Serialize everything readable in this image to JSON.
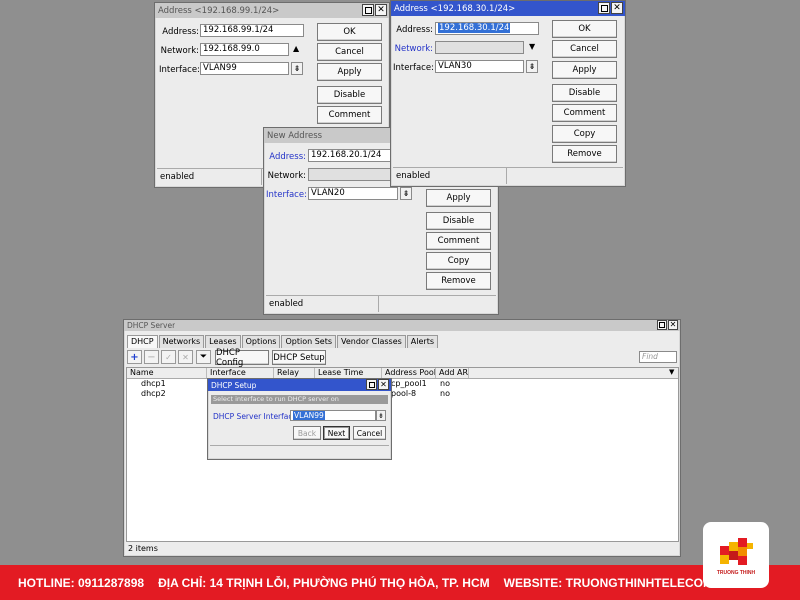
{
  "win1": {
    "title": "Address <192.168.99.1/24>",
    "address_label": "Address:",
    "address": "192.168.99.1/24",
    "network_label": "Network:",
    "network": "192.168.99.0",
    "interface_label": "Interface:",
    "interface": "VLAN99",
    "buttons": [
      "OK",
      "Cancel",
      "Apply",
      "Disable",
      "Comment"
    ],
    "status": "enabled"
  },
  "win2": {
    "title": "Address <192.168.30.1/24>",
    "address_label": "Address:",
    "address": "192.168.30.1/24",
    "network_label": "Network:",
    "network": "",
    "interface_label": "Interface:",
    "interface": "VLAN30",
    "buttons": [
      "OK",
      "Cancel",
      "Apply",
      "Disable",
      "Comment",
      "Copy",
      "Remove"
    ],
    "status": "enabled"
  },
  "win3": {
    "title": "New Address",
    "address_label": "Address:",
    "address": "192.168.20.1/24",
    "network_label": "Network:",
    "network": "",
    "interface_label": "Interface:",
    "interface": "VLAN20",
    "buttons": [
      "Apply",
      "Disable",
      "Comment",
      "Copy",
      "Remove"
    ],
    "status": "enabled"
  },
  "dhcp": {
    "title": "DHCP Server",
    "tabs": [
      "DHCP",
      "Networks",
      "Leases",
      "Options",
      "Option Sets",
      "Vendor Classes",
      "Alerts"
    ],
    "config_button": "DHCP Config",
    "setup_button": "DHCP Setup",
    "find_placeholder": "Find",
    "columns": [
      "Name",
      "Interface",
      "Relay",
      "Lease Time",
      "Address Pool",
      "Add AR..."
    ],
    "rows": [
      {
        "name": "dhcp1",
        "pool": "cp_pool1",
        "arp": "no"
      },
      {
        "name": "dhcp2",
        "pool": "pool-8",
        "arp": "no"
      }
    ],
    "status": "2 items"
  },
  "setup": {
    "title": "DHCP Setup",
    "hint": "Select interface to run DHCP server on",
    "iface_label": "DHCP Server Interface:",
    "iface_value": "VLAN99",
    "back": "Back",
    "next": "Next",
    "cancel": "Cancel"
  },
  "footer": {
    "hotline": "HOTLINE: 0911287898",
    "address": "ĐỊA CHỈ: 14 TRỊNH LỖI, PHƯỜNG PHÚ THỌ HÒA, TP. HCM",
    "website": "WEBSITE: TRUONGTHINHTELECOM.COM"
  },
  "logo": {
    "text": "TRUONG THINH"
  },
  "colors": {
    "title_active": "#3355cc",
    "footer_red": "#e31b23"
  }
}
